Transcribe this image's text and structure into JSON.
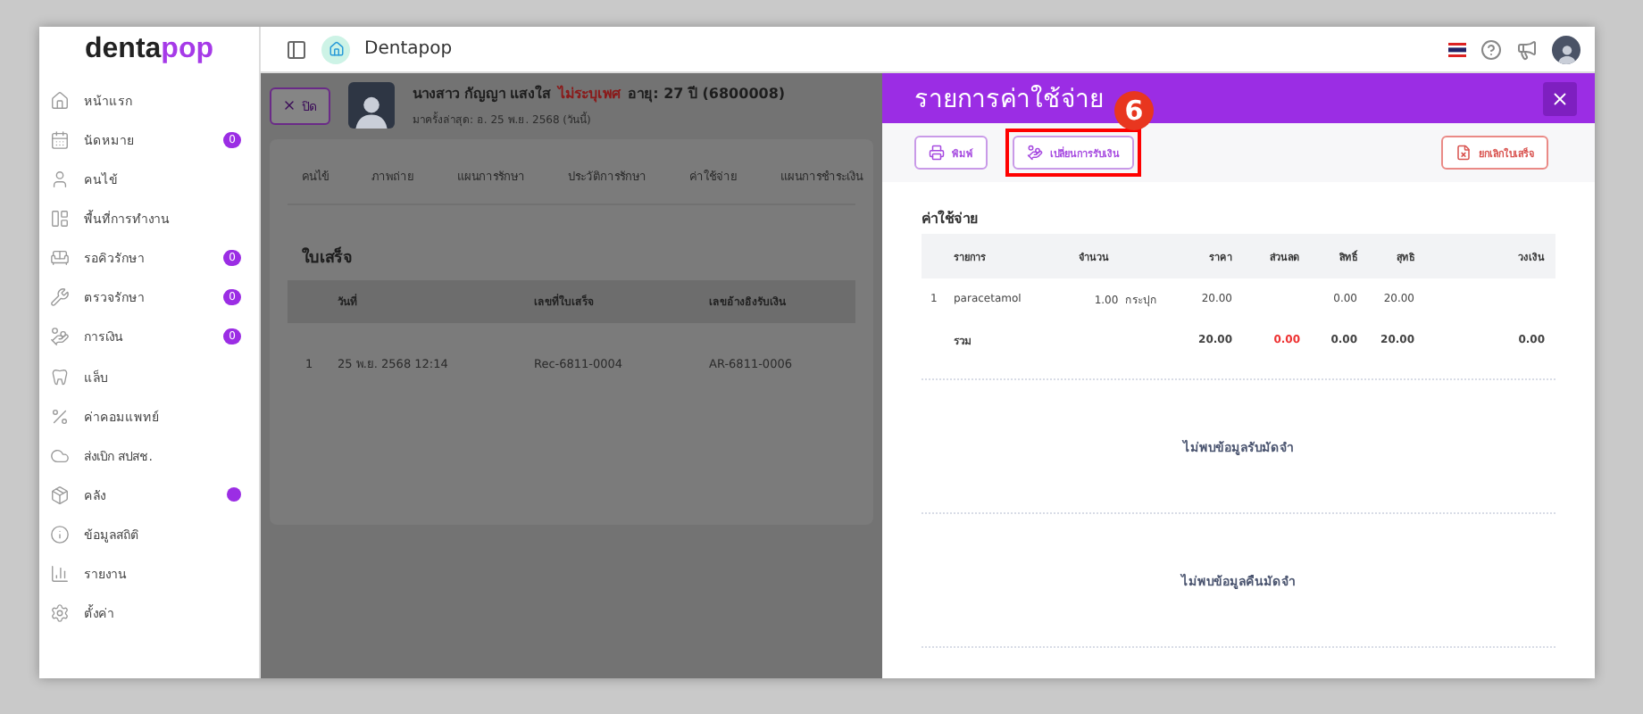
{
  "sidebar": {
    "logo": {
      "part1": "denta",
      "part2": "pop"
    },
    "items": [
      {
        "label": "หน้าแรก",
        "dot": false
      },
      {
        "label": "นัดหมาย",
        "badge": "0",
        "dot": false
      },
      {
        "label": "คนไข้",
        "dot": false
      },
      {
        "label": "พื้นที่การทำงาน",
        "dot": false
      },
      {
        "label": "รอคิวรักษา",
        "badge": "0",
        "dot": false
      },
      {
        "label": "ตรวจรักษา",
        "badge": "0",
        "dot": false
      },
      {
        "label": "การเงิน",
        "badge": "0",
        "dot": false
      },
      {
        "label": "แล็บ",
        "dot": false
      },
      {
        "label": "ค่าคอมแพทย์",
        "dot": false
      },
      {
        "label": "ส่งเบิก สปสช.",
        "dot": false
      },
      {
        "label": "คลัง",
        "dot": true
      },
      {
        "label": "ข้อมูลสถิติ",
        "dot": false
      },
      {
        "label": "รายงาน",
        "dot": false
      },
      {
        "label": "ตั้งค่า",
        "dot": false
      }
    ]
  },
  "topbar": {
    "clinic": "Dentapop"
  },
  "patient": {
    "close": "ปิด",
    "name": "นางสาว กัญญา แสงใส",
    "gender": "ไม่ระบุเพศ",
    "age": "อายุ: 27 ปี (6800008)",
    "last_visit": "มาครั้งล่าสุด: อ. 25 พ.ย. 2568 (วันนี้)"
  },
  "tabs": [
    {
      "label": "คนไข้",
      "selected": false
    },
    {
      "label": "ภาพถ่าย",
      "selected": false
    },
    {
      "label": "แผนการรักษา",
      "selected": false
    },
    {
      "label": "ประวัติการรักษา",
      "selected": false
    },
    {
      "label": "ค่าใช้จ่าย",
      "selected": false
    },
    {
      "label": "แผนการชำระเงิน",
      "selected": false
    }
  ],
  "receipts": {
    "title": "ใบเสร็จ",
    "columns": [
      "",
      "วันที่",
      "เลขที่ใบเสร็จ",
      "เลขอ้างอิงรับเงิน"
    ],
    "rows": [
      [
        "1",
        "25 พ.ย. 2568 12:14",
        "Rec-6811-0004",
        "AR-6811-0006"
      ]
    ]
  },
  "drawer": {
    "title": "รายการค่าใช้จ่าย",
    "annotation": "6",
    "buttons": [
      {
        "label": "พิมพ์",
        "kind": "print",
        "highlighted": false
      },
      {
        "label": "เปลี่ยนการรับเงิน",
        "kind": "payment",
        "highlighted": true
      },
      {
        "label": "ยกเลิกใบเสร็จ",
        "kind": "cancel",
        "highlighted": false
      }
    ],
    "expenses": {
      "title": "ค่าใช้จ่าย",
      "columns": [
        "",
        "รายการ",
        "จำนวน",
        "ราคา",
        "ส่วนลด",
        "สิทธิ์",
        "สุทธิ",
        "วงเงิน"
      ],
      "rows": [
        {
          "kind": "item",
          "cells": [
            "1",
            "paracetamol",
            "1.00  กระปุก",
            "20.00",
            "",
            "0.00",
            "20.00",
            ""
          ]
        },
        {
          "kind": "total",
          "cells": [
            "",
            "รวม",
            "",
            "20.00",
            "0.00",
            "0.00",
            "20.00",
            "0.00"
          ]
        }
      ]
    },
    "empty_messages": [
      "ไม่พบข้อมูลรับมัดจำ",
      "ไม่พบข้อมูลคืนมัดจำ"
    ]
  }
}
